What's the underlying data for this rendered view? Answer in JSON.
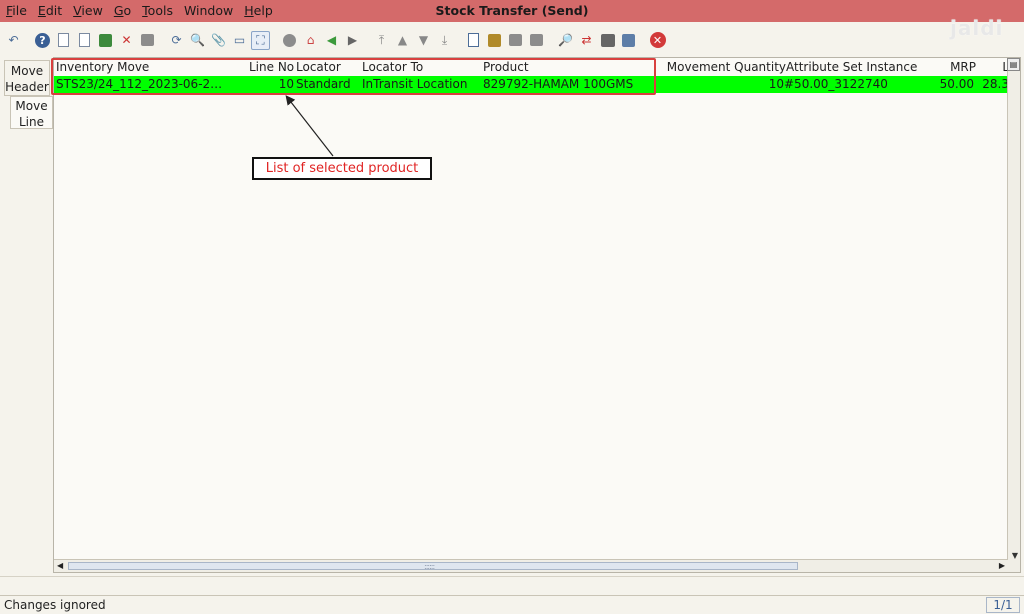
{
  "window": {
    "title": "Stock Transfer (Send)"
  },
  "menu": [
    {
      "acc": "F",
      "rest": "ile"
    },
    {
      "acc": "E",
      "rest": "dit"
    },
    {
      "acc": "V",
      "rest": "iew"
    },
    {
      "acc": "G",
      "rest": "o"
    },
    {
      "acc": "T",
      "rest": "ools"
    },
    {
      "acc": "",
      "rest": "Window"
    },
    {
      "acc": "H",
      "rest": "elp"
    }
  ],
  "logo": "jaldi",
  "tabs": {
    "header": [
      "Move",
      "Header"
    ],
    "line": [
      "Move",
      "Line"
    ]
  },
  "grid": {
    "columns": [
      "Inventory Move",
      "Line No",
      "Locator",
      "Locator To",
      "Product",
      "Movement Quantity",
      "Attribute Set Instance",
      "MRP",
      "L"
    ],
    "row": {
      "inventory_move": "STS23/24_112_2023-06-2…",
      "line_no": "10",
      "locator": "Standard",
      "locator_to": "InTransit Location",
      "product": "829792-HAMAM 100GMS",
      "movement_quantity": "10",
      "attribute_set_instance": "#50.00_3122740",
      "mrp": "50.00",
      "last": "28.3"
    },
    "row_color": "#00ff00"
  },
  "annotation": {
    "label": "List of selected product",
    "color": "#d9403f"
  },
  "status": {
    "message": "Changes ignored",
    "page": "1/1"
  }
}
